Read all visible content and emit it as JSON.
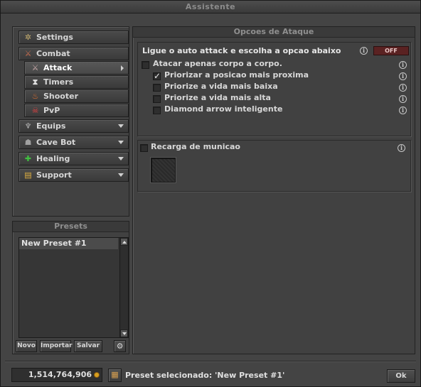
{
  "window": {
    "title": "Assistente"
  },
  "sidebar": {
    "items": [
      {
        "label": "Settings",
        "icon": "gear-icon",
        "glyph": "✲",
        "color": "#c8b070"
      },
      {
        "label": "Combat",
        "icon": "sword-icon",
        "glyph": "⚔",
        "color": "#d07050"
      },
      {
        "label": "Attack",
        "icon": "sword-icon",
        "glyph": "⚔",
        "color": "#d0b0b0"
      },
      {
        "label": "Timers",
        "icon": "hourglass-icon",
        "glyph": "⧗",
        "color": "#e0e0e0"
      },
      {
        "label": "Shooter",
        "icon": "flame-icon",
        "glyph": "♨",
        "color": "#e07030"
      },
      {
        "label": "PvP",
        "icon": "skull-icon",
        "glyph": "☠",
        "color": "#e04040"
      },
      {
        "label": "Equips",
        "icon": "amulet-icon",
        "glyph": "♆",
        "color": "#b0b0b0"
      },
      {
        "label": "Cave Bot",
        "icon": "cave-icon",
        "glyph": "☗",
        "color": "#a0a0a0"
      },
      {
        "label": "Healing",
        "icon": "heal-icon",
        "glyph": "✚",
        "color": "#40c040"
      },
      {
        "label": "Support",
        "icon": "scroll-icon",
        "glyph": "▤",
        "color": "#e0b040"
      }
    ]
  },
  "presets": {
    "title": "Presets",
    "items": [
      "New Preset #1"
    ],
    "new_label": "Novo",
    "import_label": "Importar",
    "save_label": "Salvar"
  },
  "main": {
    "title": "Opcoes de Ataque",
    "auto_attack_label": "Ligue o auto attack e escolha a opcao abaixo",
    "toggle_label": "OFF",
    "options": [
      {
        "label": "Atacar apenas corpo a corpo.",
        "checked": false
      },
      {
        "label": "Priorizar a posicao mais proxima",
        "checked": true
      },
      {
        "label": "Priorize a vida mais baixa",
        "checked": false
      },
      {
        "label": "Priorize a vida mais alta",
        "checked": false
      },
      {
        "label": "Diamond arrow inteligente",
        "checked": false
      }
    ],
    "reload_label": "Recarga de municao",
    "info_glyph": "i"
  },
  "footer": {
    "money": "1,514,764,906",
    "preset_status": "Preset selecionado: 'New Preset #1'",
    "ok_label": "Ok"
  }
}
